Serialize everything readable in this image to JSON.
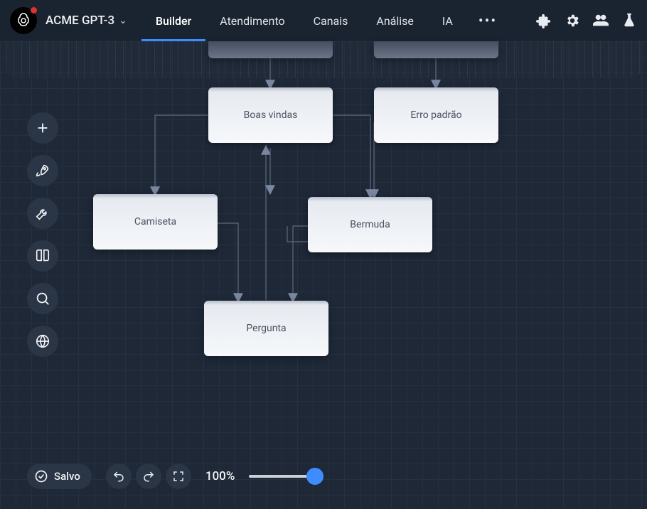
{
  "header": {
    "app_name": "ACME GPT-3",
    "tabs": {
      "builder": "Builder",
      "atendimento": "Atendimento",
      "canais": "Canais",
      "analise": "Análise",
      "ia": "IA"
    }
  },
  "nodes": {
    "boas_vindas": "Boas vindas",
    "erro_padrao": "Erro padrão",
    "camiseta": "Camiseta",
    "bermuda": "Bermuda",
    "pergunta": "Pergunta"
  },
  "bottom": {
    "saved": "Salvo",
    "zoom": "100%"
  },
  "icons": {
    "plus": "plus-icon",
    "rocket": "rocket-icon",
    "wrench": "wrench-icon",
    "book": "book-icon",
    "search": "search-icon",
    "globe": "globe-icon",
    "puzzle": "puzzle-icon",
    "gear": "gear-icon",
    "users": "users-icon",
    "flask": "flask-icon",
    "undo": "undo-icon",
    "redo": "redo-icon",
    "fullscreen": "fullscreen-icon",
    "check": "check-icon"
  }
}
